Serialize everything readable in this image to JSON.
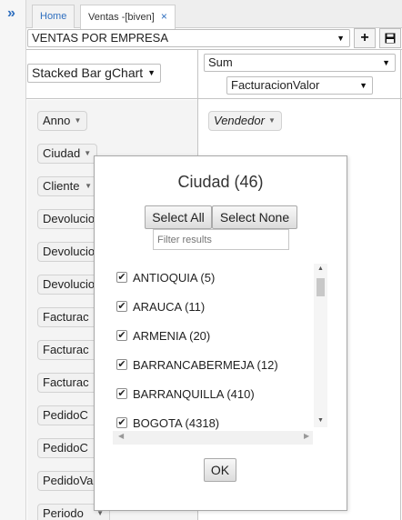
{
  "rail": {
    "expand_icon": "»"
  },
  "tabs": [
    {
      "label": "Home"
    },
    {
      "label": "Ventas -[biven]",
      "close": "×"
    }
  ],
  "report_select": {
    "value": "VENTAS POR EMPRESA"
  },
  "toolbar": {
    "add_icon": "+",
    "save_icon": "save-icon"
  },
  "renderer_select": {
    "value": "Stacked Bar gChart"
  },
  "aggregator_select": {
    "value": "Sum"
  },
  "value_select": {
    "value": "FacturacionValor"
  },
  "attributes": [
    "Anno",
    "Ciudad",
    "Cliente",
    "Devolucio",
    "Devolucio",
    "Devolucio",
    "Facturac",
    "Facturac",
    "Facturac",
    "PedidoC",
    "PedidoC",
    "PedidoVa",
    "Periodo"
  ],
  "column_attributes": [
    "Vendedor"
  ],
  "filter_dialog": {
    "title": "Ciudad (46)",
    "select_all": "Select All",
    "select_none": "Select None",
    "filter_placeholder": "Filter results",
    "items": [
      {
        "label": "ANTIOQUIA (5)",
        "checked": true
      },
      {
        "label": "ARAUCA (11)",
        "checked": true
      },
      {
        "label": "ARMENIA (20)",
        "checked": true
      },
      {
        "label": "BARRANCABERMEJA (12)",
        "checked": true
      },
      {
        "label": "BARRANQUILLA (410)",
        "checked": true
      },
      {
        "label": "BOGOTA (4318)",
        "checked": true
      }
    ],
    "ok": "OK"
  }
}
